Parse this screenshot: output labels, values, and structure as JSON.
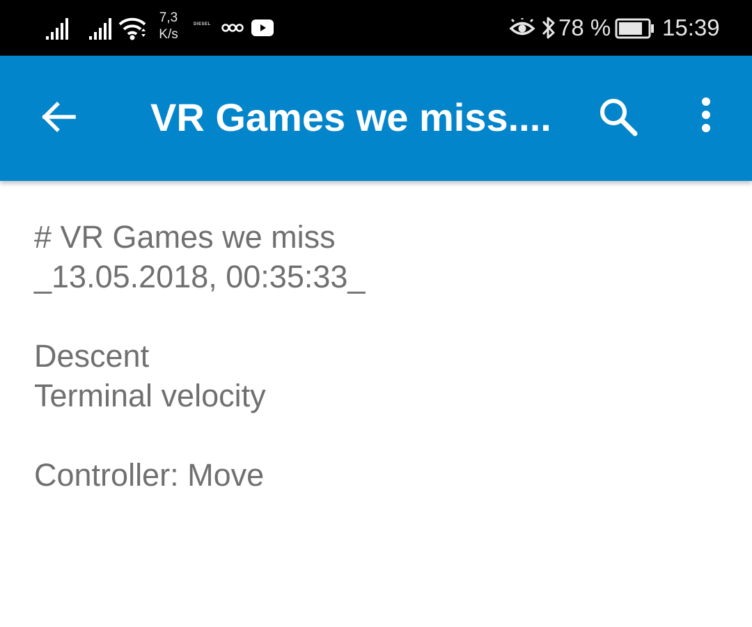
{
  "status_bar": {
    "net_speed_value": "7,3",
    "net_speed_unit": "K/s",
    "diesel_label": "DIESEL",
    "battery": "78 %",
    "clock": "15:39",
    "icons": [
      "signal-icon",
      "signal-icon",
      "wifi-icon",
      "diesel-icon",
      "infinity-icon",
      "youtube-icon",
      "eye-icon",
      "bluetooth-icon",
      "battery-icon"
    ]
  },
  "app_bar": {
    "title": "VR Games we miss....",
    "background": "#0385cb",
    "icons": [
      "back-arrow-icon",
      "search-icon",
      "more-vert-icon"
    ]
  },
  "note": {
    "lines": [
      "# VR Games we miss",
      "_13.05.2018, 00:35:33_",
      "",
      "Descent",
      "Terminal velocity",
      "",
      "Controller: Move"
    ]
  }
}
